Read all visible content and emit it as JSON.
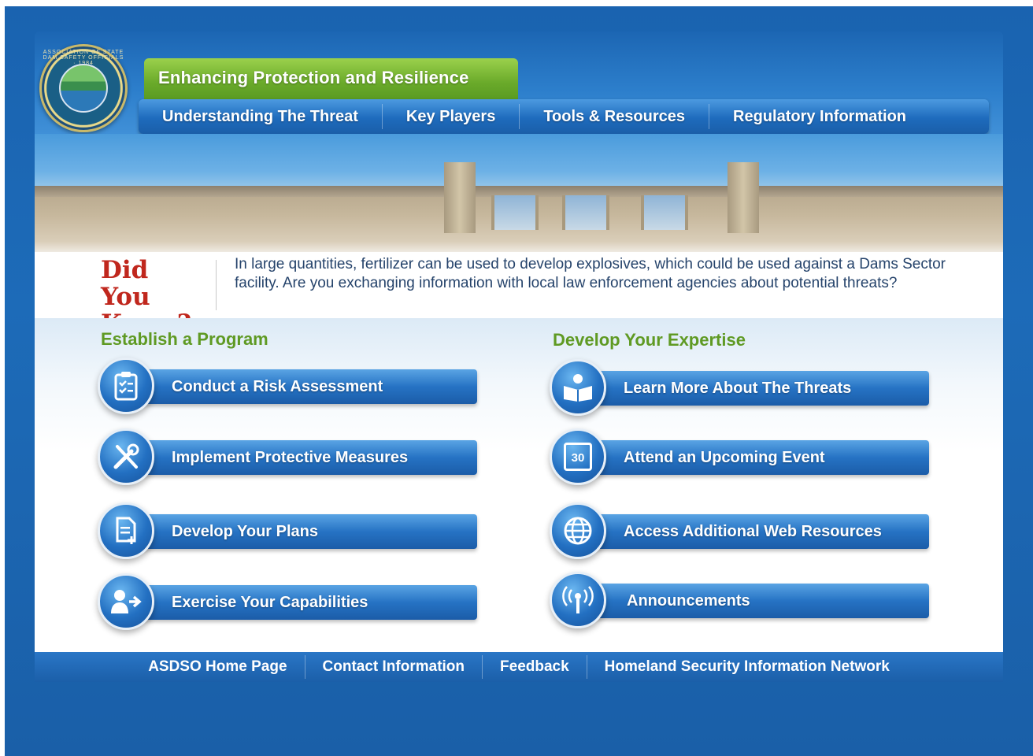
{
  "header": {
    "logo_text": "ASSOCIATION OF STATE DAM SAFETY OFFICIALS · 1984",
    "tagline": "Enhancing Protection and Resilience",
    "nav": [
      {
        "label": "Understanding The Threat"
      },
      {
        "label": "Key Players"
      },
      {
        "label": "Tools & Resources"
      },
      {
        "label": "Regulatory Information"
      }
    ]
  },
  "did_you_know": {
    "title_line1": "Did You",
    "title_line2": "Know?",
    "text": "In large quantities, fertilizer can be used to develop explosives, which could be used against a Dams Sector facility. Are you exchanging information with local law enforcement agencies about potential threats?"
  },
  "left_column": {
    "title": "Establish a Program",
    "items": [
      {
        "label": "Conduct a Risk Assessment",
        "icon": "clipboard-checklist-icon"
      },
      {
        "label": "Implement Protective Measures",
        "icon": "tools-icon"
      },
      {
        "label": "Develop Your Plans",
        "icon": "document-add-icon"
      },
      {
        "label": "Exercise Your Capabilities",
        "icon": "user-arrow-icon"
      }
    ]
  },
  "right_column": {
    "title": "Develop Your Expertise",
    "items": [
      {
        "label": "Learn More About The Threats",
        "icon": "reader-book-icon"
      },
      {
        "label": "Attend an Upcoming Event",
        "icon": "calendar-icon",
        "icon_text": "30"
      },
      {
        "label": "Access Additional Web Resources",
        "icon": "globe-icon"
      },
      {
        "label": "Announcements",
        "icon": "broadcast-antenna-icon"
      }
    ]
  },
  "footer": {
    "links": [
      {
        "label": "ASDSO Home Page"
      },
      {
        "label": "Contact Information"
      },
      {
        "label": "Feedback"
      },
      {
        "label": "Homeland Security Information Network"
      }
    ]
  }
}
